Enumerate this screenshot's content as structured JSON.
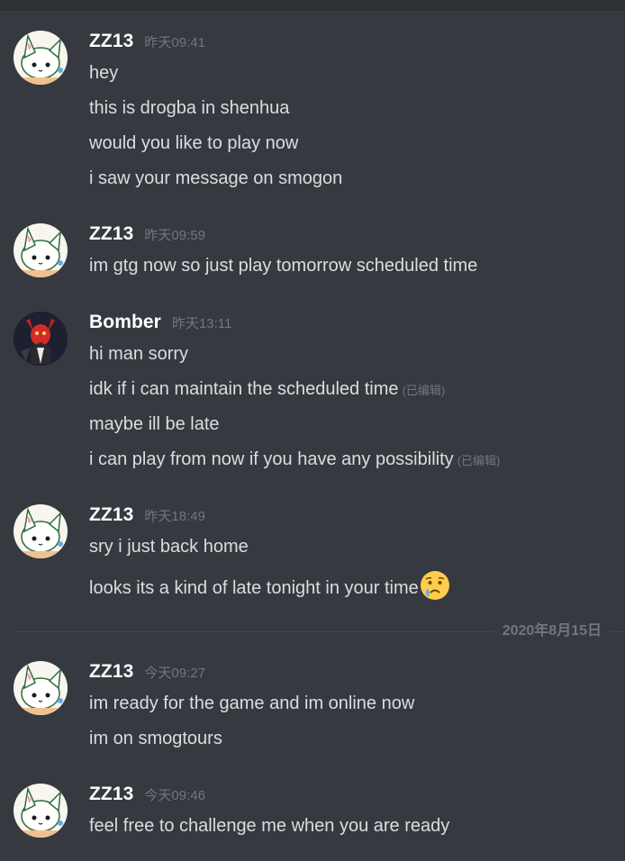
{
  "date_divider": "2020年8月15日",
  "groups": [
    {
      "username": "ZZ13",
      "timestamp": "昨天09:41",
      "avatar": "cat-avatar",
      "lines": [
        "hey",
        "this is drogba in shenhua",
        "would you like to play now",
        "i saw your message on smogon"
      ]
    },
    {
      "username": "ZZ13",
      "timestamp": "昨天09:59",
      "avatar": "cat-avatar",
      "lines": [
        "im gtg now so just play tomorrow scheduled time"
      ]
    },
    {
      "username": "Bomber",
      "timestamp": "昨天13:11",
      "avatar": "red-character-avatar",
      "lines": [
        "hi man sorry",
        "idk if i can maintain the scheduled time",
        "maybe ill be late",
        "i can play from now if you have any possibility"
      ],
      "edited_label": "(已编辑)"
    },
    {
      "username": "ZZ13",
      "timestamp": "昨天18:49",
      "avatar": "cat-avatar",
      "lines": [
        "sry i just back home",
        "looks its a kind of late tonight in your time"
      ],
      "emoji": "crying-face-emoji"
    },
    {
      "username": "ZZ13",
      "timestamp": "今天09:27",
      "avatar": "cat-avatar",
      "lines": [
        "im ready for the game and im online now",
        "im on smogtours"
      ]
    },
    {
      "username": "ZZ13",
      "timestamp": "今天09:46",
      "avatar": "cat-avatar",
      "lines": [
        "feel free to challenge me when you are ready"
      ]
    }
  ]
}
